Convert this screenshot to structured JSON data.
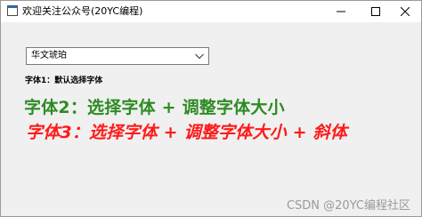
{
  "window": {
    "title": "欢迎关注公众号(20YC编程)",
    "icon": "app-window-icon"
  },
  "font_select": {
    "value": "华文琥珀"
  },
  "labels": {
    "font1": "字体1：默认选择字体",
    "font2": "字体2：选择字体 + 调整字体大小",
    "font3": "字体3：选择字体 + 调整字体大小 + 斜体"
  },
  "watermark": "CSDN @20YC编程社区",
  "colors": {
    "font2": "#2e8b23",
    "font3": "#ff1a1a",
    "window_bg": "#f0f0f0"
  }
}
